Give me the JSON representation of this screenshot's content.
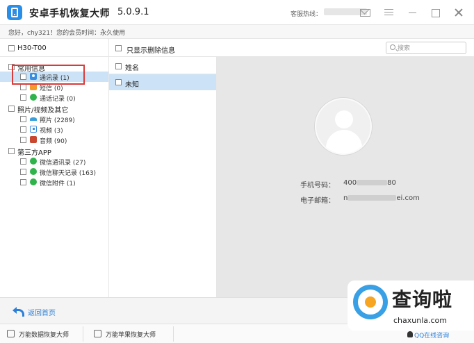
{
  "titlebar": {
    "app_title": "安卓手机恢复大师",
    "version": "5.0.9.1",
    "hotline_label": "客服热线："
  },
  "greeting": "您好，chy321！您的会员时间：永久使用",
  "toolbar": {
    "device": "H30-T00",
    "only_deleted": "只显示删除信息",
    "search_placeholder": "搜索"
  },
  "sidebar": {
    "categories": [
      {
        "label": "常用信息"
      },
      {
        "label": "照片/视频及其它"
      },
      {
        "label": "第三方APP"
      }
    ],
    "items": [
      {
        "label": "通讯录 (1)",
        "icon": "contacts-icon"
      },
      {
        "label": "短信 (0)",
        "icon": "sms-icon"
      },
      {
        "label": "通话记录 (0)",
        "icon": "call-log-icon"
      },
      {
        "label": "照片 (2289)",
        "icon": "photos-icon"
      },
      {
        "label": "视频 (3)",
        "icon": "video-icon"
      },
      {
        "label": "音频 (90)",
        "icon": "audio-icon"
      },
      {
        "label": "微信通讯录 (27)",
        "icon": "wechat-icon"
      },
      {
        "label": "微信聊天记录 (163)",
        "icon": "wechat-icon"
      },
      {
        "label": "微信附件 (1)",
        "icon": "wechat-icon"
      }
    ]
  },
  "list": {
    "header": "姓名",
    "rows": [
      {
        "label": "未知"
      }
    ]
  },
  "detail": {
    "phone_label": "手机号码：",
    "phone_prefix": "400",
    "phone_suffix": "80",
    "email_label": "电子邮箱：",
    "email_prefix": "n",
    "email_suffix": "ei.com"
  },
  "bottom": {
    "back_label": "返回首页"
  },
  "statusbar": {
    "btn1": "万能数据恢复大师",
    "btn2": "万能苹果恢复大师",
    "qq_link": "QQ在线咨询"
  },
  "watermark": {
    "text": "查询啦",
    "url": "chaxunla.com"
  },
  "colors": {
    "accent": "#2b7fd9",
    "selection": "#cce3f7",
    "highlight_box": "#d93a3a"
  }
}
